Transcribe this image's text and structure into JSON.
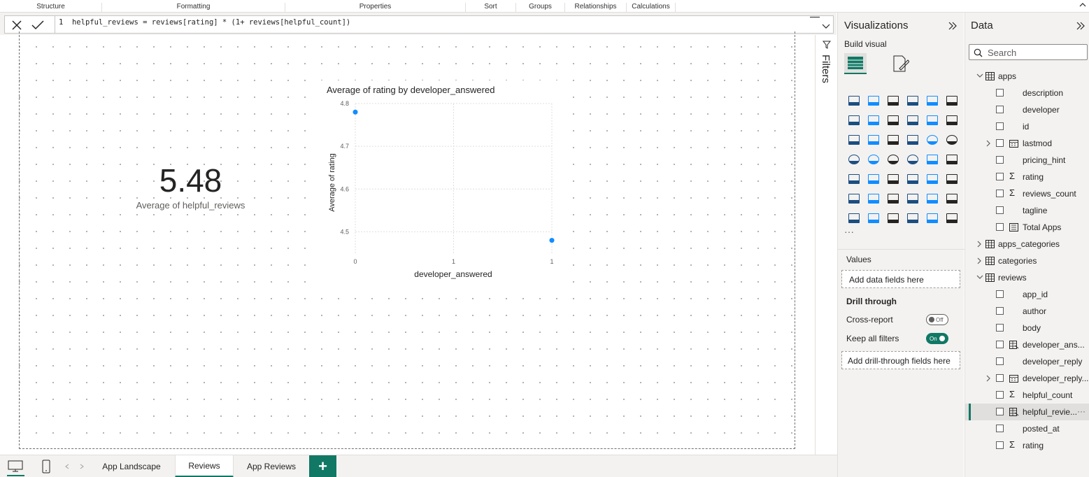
{
  "ribbon": {
    "groups": [
      "Structure",
      "Formatting",
      "Properties",
      "Sort",
      "Groups",
      "Relationships",
      "Calculations"
    ]
  },
  "formula_bar": {
    "line_number": "1",
    "expression": "helpful_reviews = reviews[rating] * (1+ reviews[helpful_count])"
  },
  "card": {
    "value": "5.48",
    "label": "Average of helpful_reviews"
  },
  "chart_data": {
    "type": "scatter",
    "title": "Average of rating by developer_answered",
    "xlabel": "developer_answered",
    "ylabel": "Average of rating",
    "x_ticks": [
      "0",
      "1",
      "1"
    ],
    "y_ticks": [
      "4.8",
      "4.7",
      "4.6",
      "4.5"
    ],
    "xlim": [
      0,
      1
    ],
    "ylim": [
      4.45,
      4.8
    ],
    "points": [
      {
        "x": 0,
        "y": 4.78
      },
      {
        "x": 1,
        "y": 4.48
      }
    ],
    "color": "#118dff",
    "grid": true
  },
  "filters": {
    "label": "Filters"
  },
  "visualizations": {
    "title": "Visualizations",
    "build_visual": "Build visual",
    "more": "···",
    "values_label": "Values",
    "values_placeholder": "Add data fields here",
    "drill_through_label": "Drill through",
    "cross_report_label": "Cross-report",
    "cross_report_state": "Off",
    "keep_filters_label": "Keep all filters",
    "keep_filters_state": "On",
    "drill_placeholder": "Add drill-through fields here",
    "accent": "#117865",
    "icons": [
      "stacked-bar-icon",
      "stacked-column-icon",
      "clustered-bar-icon",
      "clustered-column-icon",
      "100-bar-icon",
      "100-column-icon",
      "line-icon",
      "area-icon",
      "stacked-area-icon",
      "100-area-icon",
      "line-column-icon",
      "line-clustered-icon",
      "ribbon-icon",
      "waterfall-icon",
      "funnel-icon",
      "scatter-icon",
      "pie-icon",
      "donut-icon",
      "treemap-icon",
      "map-icon",
      "filled-map-icon",
      "azure-map-icon",
      "gauge-icon",
      "card-icon",
      "multirow-card-icon",
      "kpi-icon",
      "slicer-icon",
      "table-icon",
      "matrix-icon",
      "r-visual-icon",
      "python-visual-icon",
      "key-influencers-icon",
      "decomposition-tree-icon",
      "qa-icon",
      "narrative-icon",
      "metrics-icon",
      "paginated-report-icon",
      "power-apps-icon",
      "power-automate-icon",
      "new-card-icon",
      "custom-icon-1",
      "custom-icon-2"
    ]
  },
  "data_pane": {
    "title": "Data",
    "search_placeholder": "Search",
    "items": [
      {
        "label": "apps",
        "kind": "table",
        "expanded": true
      },
      {
        "label": "description",
        "kind": "field"
      },
      {
        "label": "developer",
        "kind": "field"
      },
      {
        "label": "id",
        "kind": "field"
      },
      {
        "label": "lastmod",
        "kind": "date"
      },
      {
        "label": "pricing_hint",
        "kind": "field"
      },
      {
        "label": "rating",
        "kind": "sum"
      },
      {
        "label": "reviews_count",
        "kind": "sum"
      },
      {
        "label": "tagline",
        "kind": "field"
      },
      {
        "label": "Total Apps",
        "kind": "measure"
      },
      {
        "label": "apps_categories",
        "kind": "table",
        "expanded": false
      },
      {
        "label": "categories",
        "kind": "table",
        "expanded": false
      },
      {
        "label": "reviews",
        "kind": "table",
        "expanded": true
      },
      {
        "label": "app_id",
        "kind": "field"
      },
      {
        "label": "author",
        "kind": "field"
      },
      {
        "label": "body",
        "kind": "field"
      },
      {
        "label": "developer_ans...",
        "kind": "calc"
      },
      {
        "label": "developer_reply",
        "kind": "field"
      },
      {
        "label": "developer_reply...",
        "kind": "date"
      },
      {
        "label": "helpful_count",
        "kind": "sum"
      },
      {
        "label": "helpful_revie...",
        "kind": "calc",
        "selected": true,
        "more": "···"
      },
      {
        "label": "posted_at",
        "kind": "field"
      },
      {
        "label": "rating",
        "kind": "sum"
      }
    ]
  },
  "tabs": {
    "items": [
      "App Landscape",
      "Reviews",
      "App Reviews"
    ],
    "active": "Reviews",
    "add": "+"
  }
}
